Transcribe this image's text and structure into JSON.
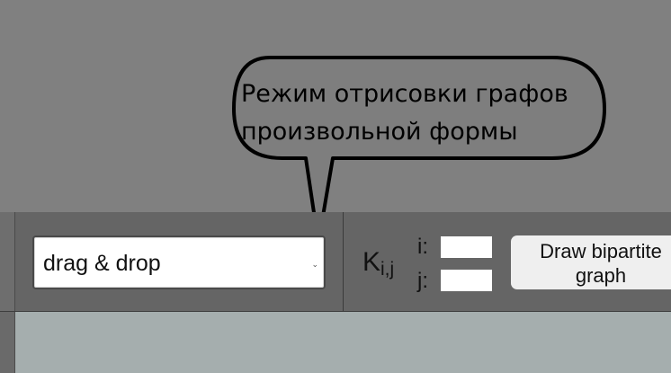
{
  "tooltip": {
    "line1": "Режим отрисовки графов",
    "line2": "произвольной формы"
  },
  "toolbar": {
    "mode_select": {
      "value": "drag & drop"
    },
    "bipartite": {
      "symbol": "K",
      "subscript": "i,j",
      "i_label": "i:",
      "j_label": "j:",
      "i_value": "",
      "j_value": "",
      "button_label_line1": "Draw bipartite",
      "button_label_line2": "graph"
    }
  },
  "colors": {
    "background": "#808080",
    "toolbar": "#656565",
    "canvas": "#a5aeae",
    "button": "#efefef"
  }
}
